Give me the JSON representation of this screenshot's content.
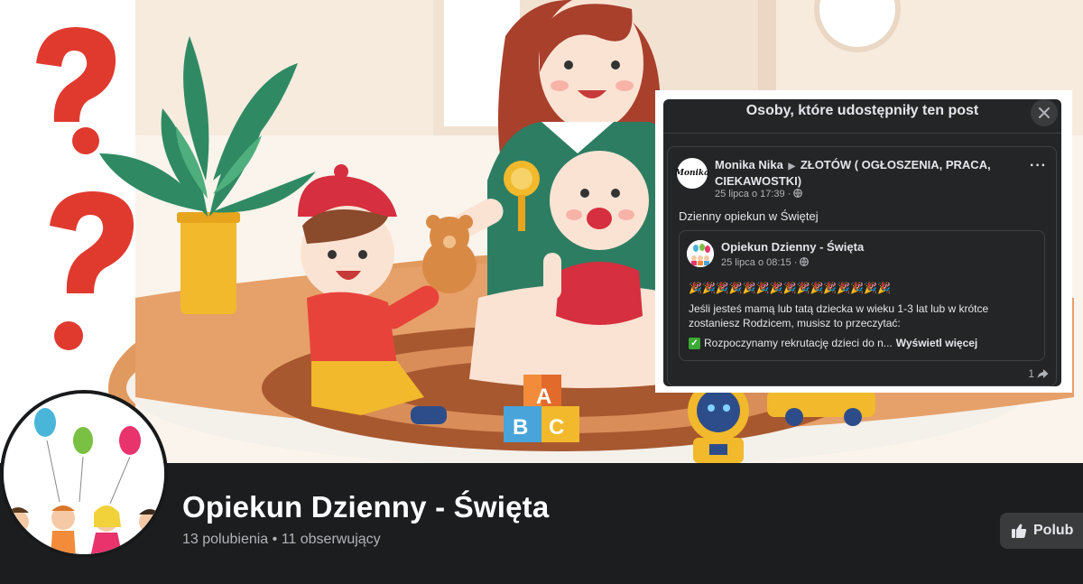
{
  "popup": {
    "title": "Osoby, które udostępniły ten post",
    "share": {
      "author_avatar_text": "Monika",
      "author": "Monika Nika",
      "group": "ZŁOTÓW ( OGŁOSZENIA, PRACA, CIEKAWOSTKI)",
      "timestamp": "25 lipca o 17:39 ·",
      "text": "Dzienny opiekun w Świętej",
      "original_post": {
        "page": "Opiekun Dzienny - Święta",
        "timestamp": "25 lipca o 08:15 ·",
        "emoji_line": "🎉🎉🎉🎉🎉🎉🎉🎉🎉🎉🎉🎉🎉🎉🎉",
        "body": "Jeśli jesteś mamą lub tatą dziecka w wieku 1-3 lat lub w krótce zostaniesz Rodzicem, musisz to przeczytać:",
        "check_line": "Rozpoczynamy rekrutację dzieci do n...",
        "see_more": "Wyświetl więcej"
      },
      "share_count": "1"
    }
  },
  "page": {
    "name": "Opiekun Dzienny - Święta",
    "stats": "13 polubienia • 11 obserwujący",
    "like_button": "Polub"
  },
  "icons": {
    "close": "close-icon",
    "more": "more-options-icon",
    "globe": "globe-icon",
    "share": "share-icon",
    "like": "thumbs-up-icon"
  },
  "colors": {
    "page_bg": "#18191a",
    "card_bg": "#242526",
    "text_primary": "#e4e6eb",
    "text_secondary": "#b0b3b8",
    "question_mark": "#e03a2f"
  }
}
